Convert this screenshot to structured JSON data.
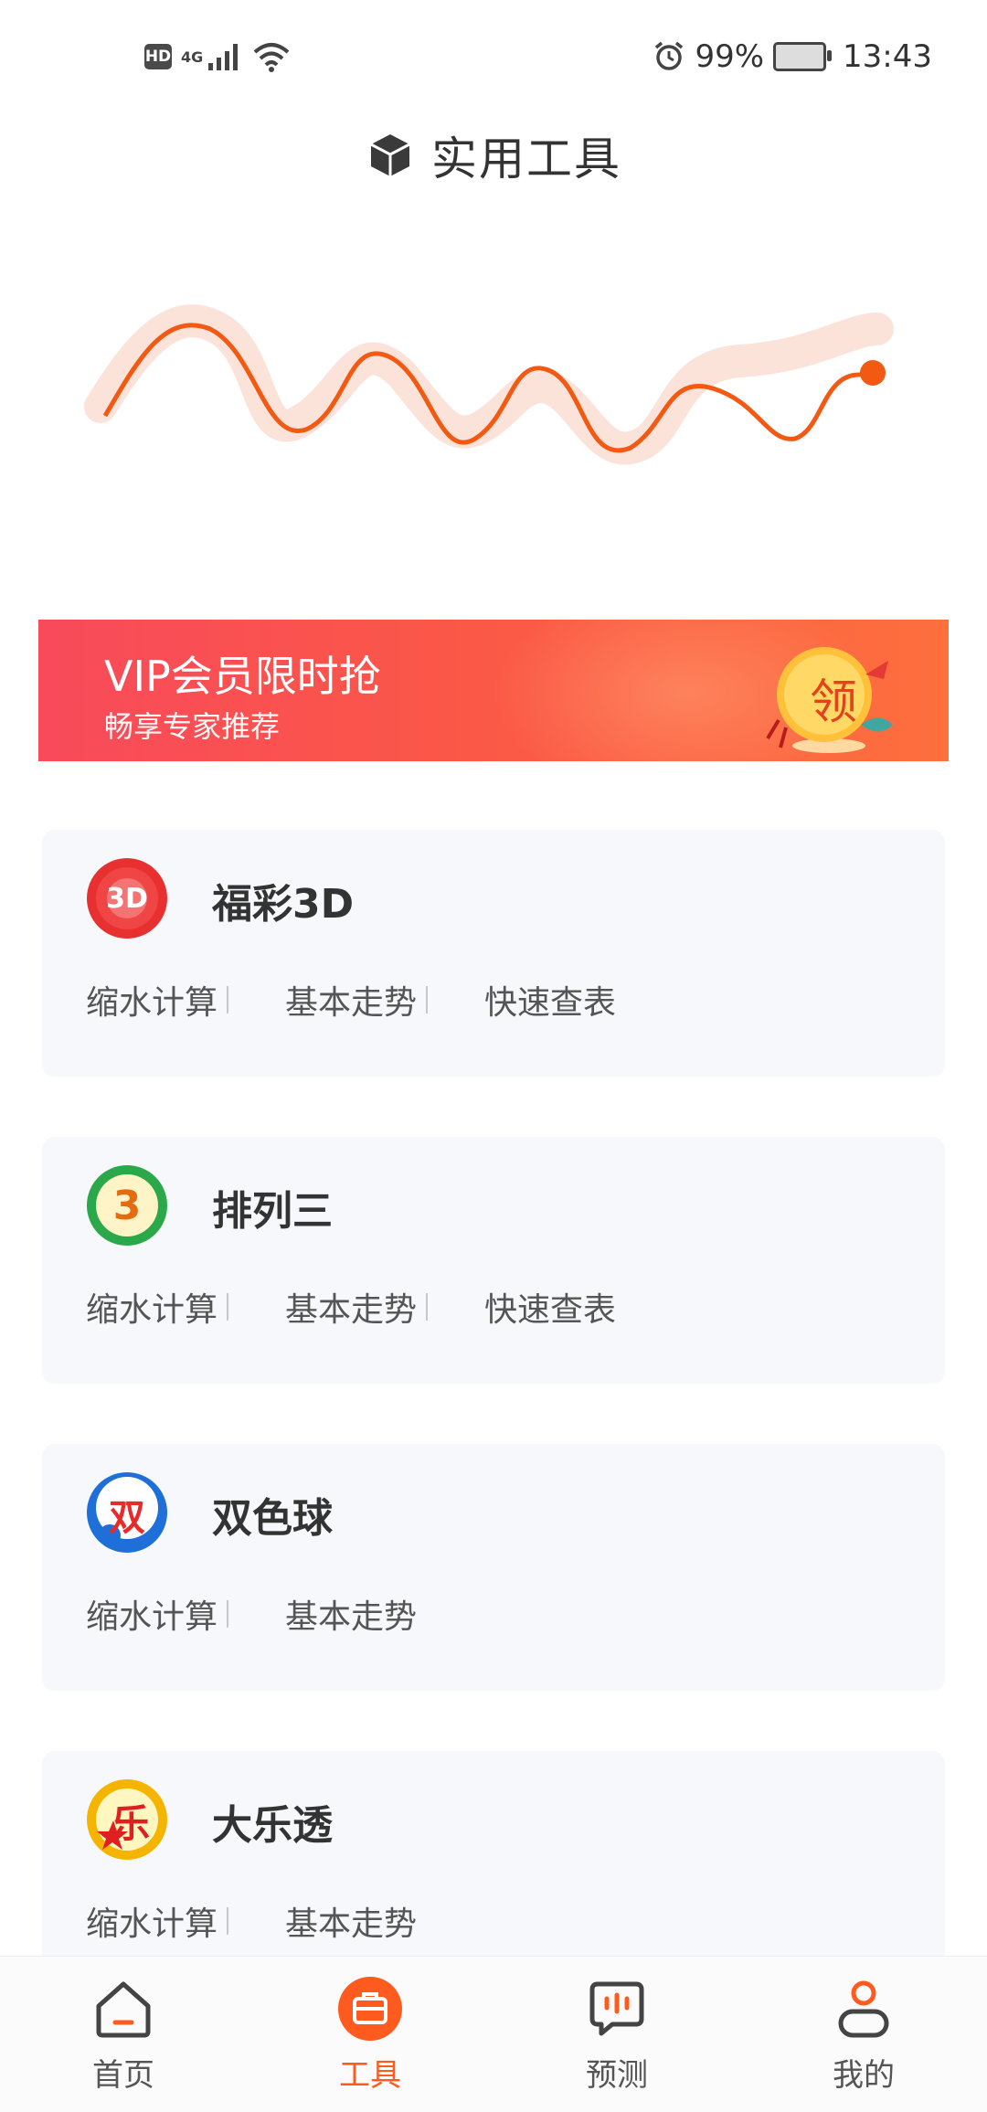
{
  "status_bar": {
    "hd": "HD",
    "network": "4G",
    "battery": "99%",
    "time": "13:43"
  },
  "header": {
    "title": "实用工具",
    "icon": "cube-icon"
  },
  "banner": {
    "title": "VIP会员限时抢",
    "subtitle": "畅享专家推荐",
    "coin_label": "领"
  },
  "tools": [
    {
      "name": "福彩3D",
      "logo_text": "3D",
      "logo_color": "#e83030",
      "links": [
        "缩水计算",
        "基本走势",
        "快速查表"
      ]
    },
    {
      "name": "排列三",
      "logo_text": "3",
      "logo_color": "#2aa84a",
      "links": [
        "缩水计算",
        "基本走势",
        "快速查表"
      ]
    },
    {
      "name": "双色球",
      "logo_text": "双",
      "logo_color": "#1e6fd8",
      "links": [
        "缩水计算",
        "基本走势"
      ]
    },
    {
      "name": "大乐透",
      "logo_text": "乐",
      "logo_color": "#f5b400",
      "links": [
        "缩水计算",
        "基本走势"
      ]
    }
  ],
  "nav": [
    {
      "label": "首页",
      "icon": "home-icon"
    },
    {
      "label": "工具",
      "icon": "toolbox-icon",
      "active": true
    },
    {
      "label": "预测",
      "icon": "chat-bars-icon"
    },
    {
      "label": "我的",
      "icon": "user-icon"
    }
  ],
  "colors": {
    "accent": "#ff5b1f",
    "banner_start": "#f84a5b",
    "banner_end": "#fd6f3d"
  }
}
